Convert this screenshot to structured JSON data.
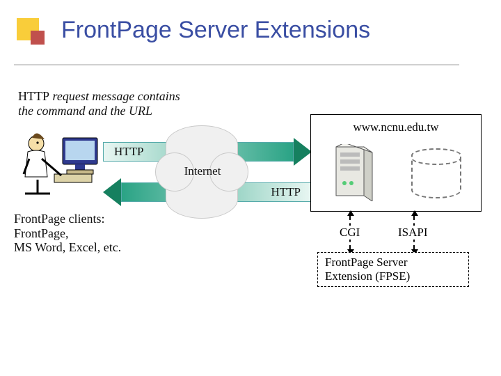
{
  "title": "FrontPage Server Extensions",
  "note_http_line1_plain": "HTTP",
  "note_http_line1_italic": " request message contains",
  "note_http_line2_italic": "the command and the URL",
  "clients_lines": {
    "l1": "FrontPage clients:",
    "l2": "FrontPage,",
    "l3": "MS Word, Excel, etc."
  },
  "arrow_top_label": "HTTP",
  "arrow_bottom_label": "HTTP",
  "cloud_label": "Internet",
  "server_domain": "www.ncnu.edu.tw",
  "tech": {
    "cgi": "CGI",
    "isapi": "ISAPI"
  },
  "fpse_line1": "FrontPage Server",
  "fpse_line2": "Extension (FPSE)",
  "icons": {
    "user_computer": "user-at-computer-icon",
    "server": "server-tower-icon",
    "database": "database-cylinder-icon",
    "cloud": "internet-cloud-icon"
  }
}
